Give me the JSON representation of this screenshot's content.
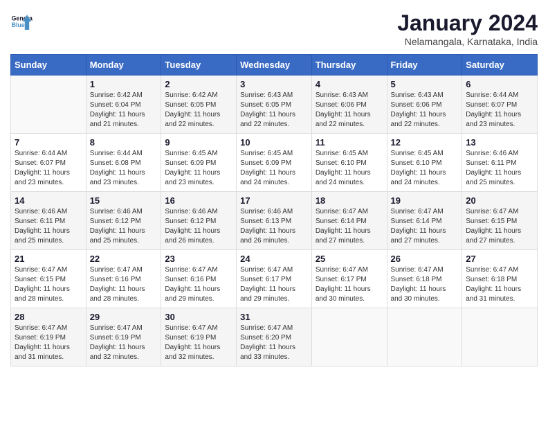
{
  "header": {
    "logo_line1": "General",
    "logo_line2": "Blue",
    "month_title": "January 2024",
    "location": "Nelamangala, Karnataka, India"
  },
  "days_of_week": [
    "Sunday",
    "Monday",
    "Tuesday",
    "Wednesday",
    "Thursday",
    "Friday",
    "Saturday"
  ],
  "weeks": [
    [
      {
        "day": "",
        "info": ""
      },
      {
        "day": "1",
        "info": "Sunrise: 6:42 AM\nSunset: 6:04 PM\nDaylight: 11 hours\nand 21 minutes."
      },
      {
        "day": "2",
        "info": "Sunrise: 6:42 AM\nSunset: 6:05 PM\nDaylight: 11 hours\nand 22 minutes."
      },
      {
        "day": "3",
        "info": "Sunrise: 6:43 AM\nSunset: 6:05 PM\nDaylight: 11 hours\nand 22 minutes."
      },
      {
        "day": "4",
        "info": "Sunrise: 6:43 AM\nSunset: 6:06 PM\nDaylight: 11 hours\nand 22 minutes."
      },
      {
        "day": "5",
        "info": "Sunrise: 6:43 AM\nSunset: 6:06 PM\nDaylight: 11 hours\nand 22 minutes."
      },
      {
        "day": "6",
        "info": "Sunrise: 6:44 AM\nSunset: 6:07 PM\nDaylight: 11 hours\nand 23 minutes."
      }
    ],
    [
      {
        "day": "7",
        "info": "Sunrise: 6:44 AM\nSunset: 6:07 PM\nDaylight: 11 hours\nand 23 minutes."
      },
      {
        "day": "8",
        "info": "Sunrise: 6:44 AM\nSunset: 6:08 PM\nDaylight: 11 hours\nand 23 minutes."
      },
      {
        "day": "9",
        "info": "Sunrise: 6:45 AM\nSunset: 6:09 PM\nDaylight: 11 hours\nand 23 minutes."
      },
      {
        "day": "10",
        "info": "Sunrise: 6:45 AM\nSunset: 6:09 PM\nDaylight: 11 hours\nand 24 minutes."
      },
      {
        "day": "11",
        "info": "Sunrise: 6:45 AM\nSunset: 6:10 PM\nDaylight: 11 hours\nand 24 minutes."
      },
      {
        "day": "12",
        "info": "Sunrise: 6:45 AM\nSunset: 6:10 PM\nDaylight: 11 hours\nand 24 minutes."
      },
      {
        "day": "13",
        "info": "Sunrise: 6:46 AM\nSunset: 6:11 PM\nDaylight: 11 hours\nand 25 minutes."
      }
    ],
    [
      {
        "day": "14",
        "info": "Sunrise: 6:46 AM\nSunset: 6:11 PM\nDaylight: 11 hours\nand 25 minutes."
      },
      {
        "day": "15",
        "info": "Sunrise: 6:46 AM\nSunset: 6:12 PM\nDaylight: 11 hours\nand 25 minutes."
      },
      {
        "day": "16",
        "info": "Sunrise: 6:46 AM\nSunset: 6:12 PM\nDaylight: 11 hours\nand 26 minutes."
      },
      {
        "day": "17",
        "info": "Sunrise: 6:46 AM\nSunset: 6:13 PM\nDaylight: 11 hours\nand 26 minutes."
      },
      {
        "day": "18",
        "info": "Sunrise: 6:47 AM\nSunset: 6:14 PM\nDaylight: 11 hours\nand 27 minutes."
      },
      {
        "day": "19",
        "info": "Sunrise: 6:47 AM\nSunset: 6:14 PM\nDaylight: 11 hours\nand 27 minutes."
      },
      {
        "day": "20",
        "info": "Sunrise: 6:47 AM\nSunset: 6:15 PM\nDaylight: 11 hours\nand 27 minutes."
      }
    ],
    [
      {
        "day": "21",
        "info": "Sunrise: 6:47 AM\nSunset: 6:15 PM\nDaylight: 11 hours\nand 28 minutes."
      },
      {
        "day": "22",
        "info": "Sunrise: 6:47 AM\nSunset: 6:16 PM\nDaylight: 11 hours\nand 28 minutes."
      },
      {
        "day": "23",
        "info": "Sunrise: 6:47 AM\nSunset: 6:16 PM\nDaylight: 11 hours\nand 29 minutes."
      },
      {
        "day": "24",
        "info": "Sunrise: 6:47 AM\nSunset: 6:17 PM\nDaylight: 11 hours\nand 29 minutes."
      },
      {
        "day": "25",
        "info": "Sunrise: 6:47 AM\nSunset: 6:17 PM\nDaylight: 11 hours\nand 30 minutes."
      },
      {
        "day": "26",
        "info": "Sunrise: 6:47 AM\nSunset: 6:18 PM\nDaylight: 11 hours\nand 30 minutes."
      },
      {
        "day": "27",
        "info": "Sunrise: 6:47 AM\nSunset: 6:18 PM\nDaylight: 11 hours\nand 31 minutes."
      }
    ],
    [
      {
        "day": "28",
        "info": "Sunrise: 6:47 AM\nSunset: 6:19 PM\nDaylight: 11 hours\nand 31 minutes."
      },
      {
        "day": "29",
        "info": "Sunrise: 6:47 AM\nSunset: 6:19 PM\nDaylight: 11 hours\nand 32 minutes."
      },
      {
        "day": "30",
        "info": "Sunrise: 6:47 AM\nSunset: 6:19 PM\nDaylight: 11 hours\nand 32 minutes."
      },
      {
        "day": "31",
        "info": "Sunrise: 6:47 AM\nSunset: 6:20 PM\nDaylight: 11 hours\nand 33 minutes."
      },
      {
        "day": "",
        "info": ""
      },
      {
        "day": "",
        "info": ""
      },
      {
        "day": "",
        "info": ""
      }
    ]
  ]
}
